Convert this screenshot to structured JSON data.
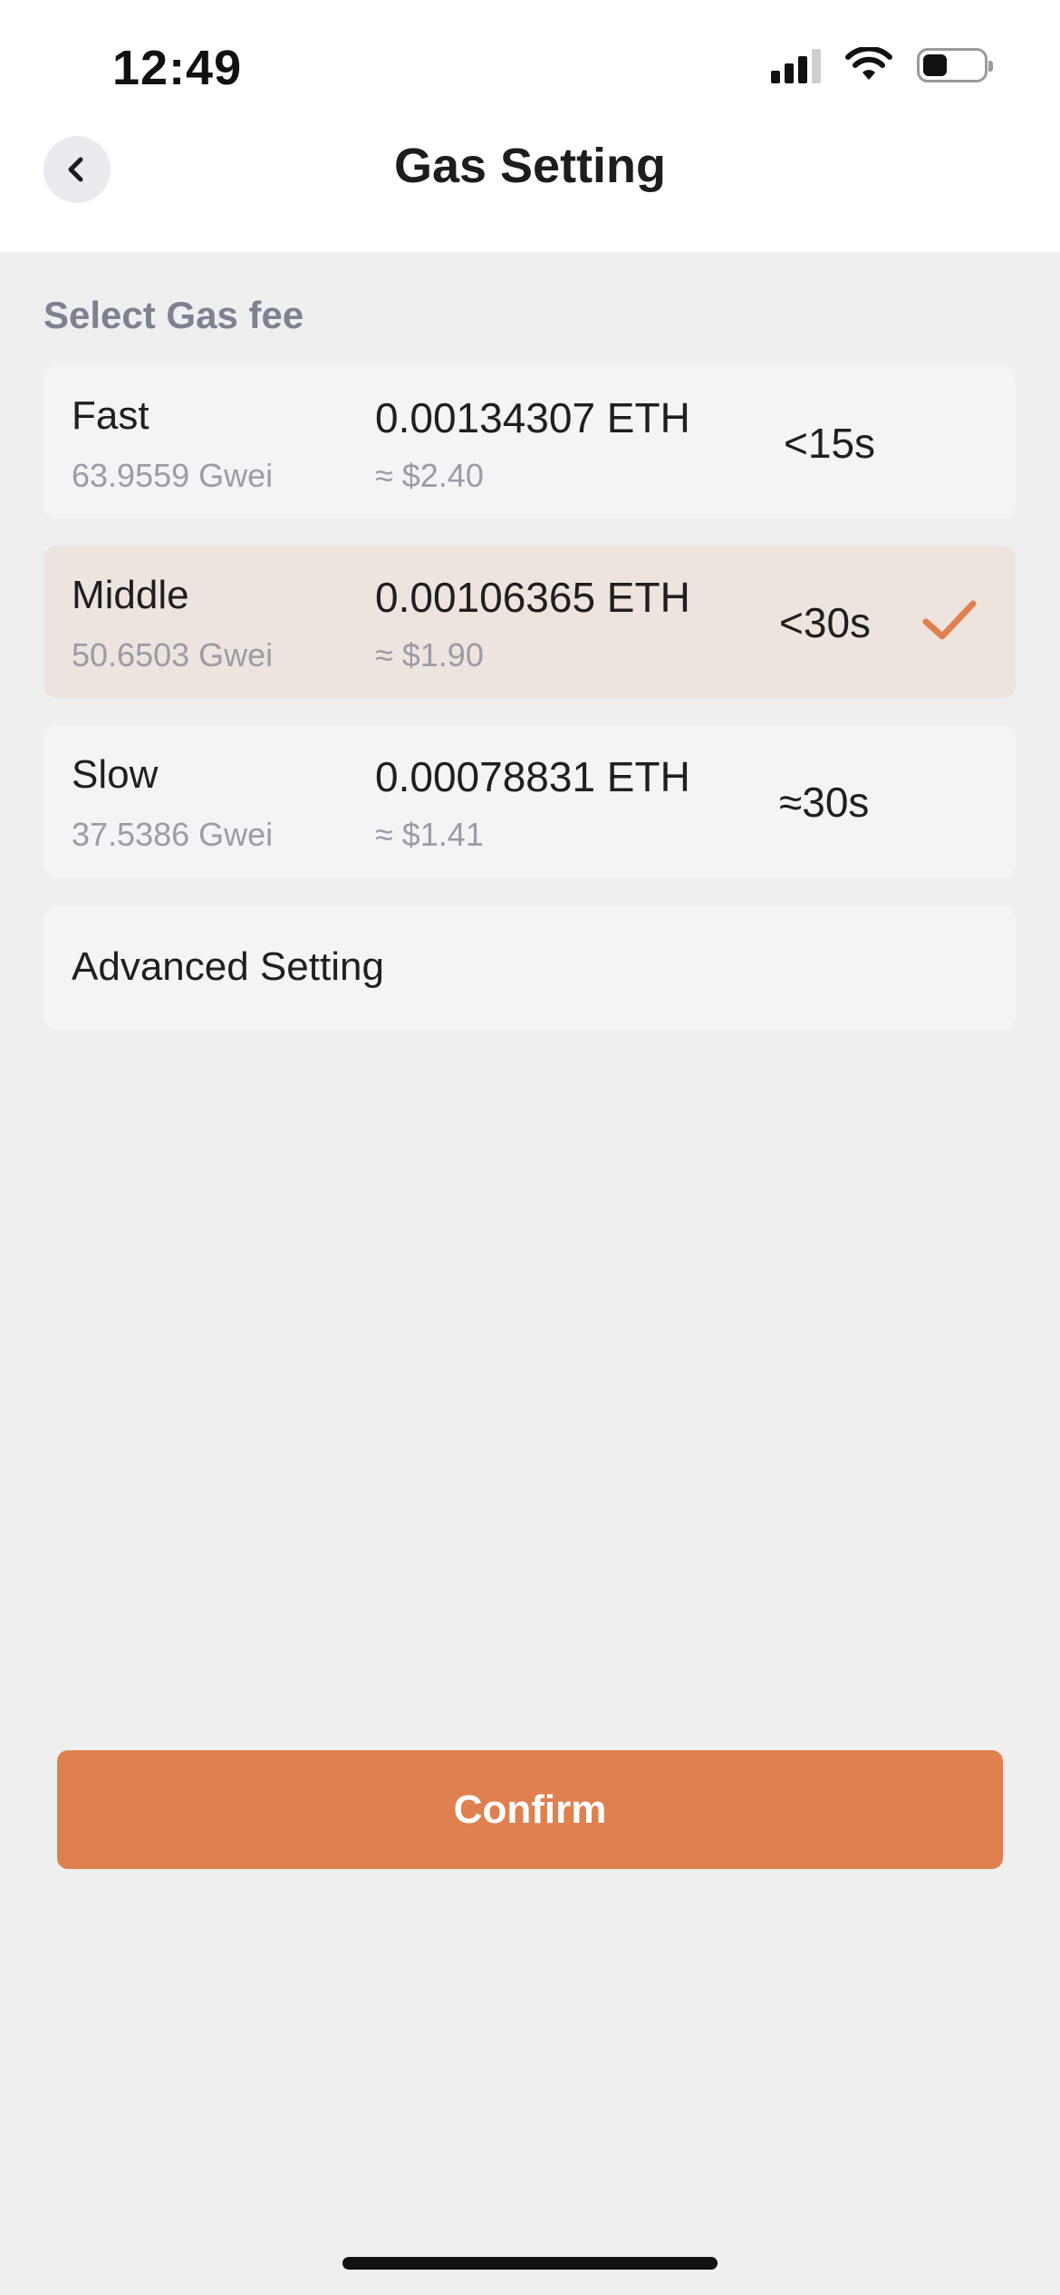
{
  "status_bar": {
    "time": "12:49",
    "icons": [
      "signal-icon",
      "wifi-icon",
      "battery-icon"
    ]
  },
  "header": {
    "title": "Gas Setting",
    "back_icon": "chevron-left-icon"
  },
  "section": {
    "title": "Select Gas fee"
  },
  "options": [
    {
      "name": "Fast",
      "gwei": "63.9559 Gwei",
      "eth": "0.00134307 ETH",
      "usd": "≈ $2.40",
      "time": "<15s",
      "selected": false
    },
    {
      "name": "Middle",
      "gwei": "50.6503 Gwei",
      "eth": "0.00106365 ETH",
      "usd": "≈ $1.90",
      "time": "<30s",
      "selected": true
    },
    {
      "name": "Slow",
      "gwei": "37.5386 Gwei",
      "eth": "0.00078831 ETH",
      "usd": "≈ $1.41",
      "time": "≈30s",
      "selected": false
    }
  ],
  "advanced": {
    "label": "Advanced Setting"
  },
  "confirm": {
    "label": "Confirm"
  },
  "colors": {
    "accent": "#de814f",
    "selected_bg": "#ede4de",
    "card_bg": "#f3f4f6",
    "page_bg": "#efefef",
    "secondary_text": "#9a9ca6",
    "section_text": "#7d8190"
  }
}
